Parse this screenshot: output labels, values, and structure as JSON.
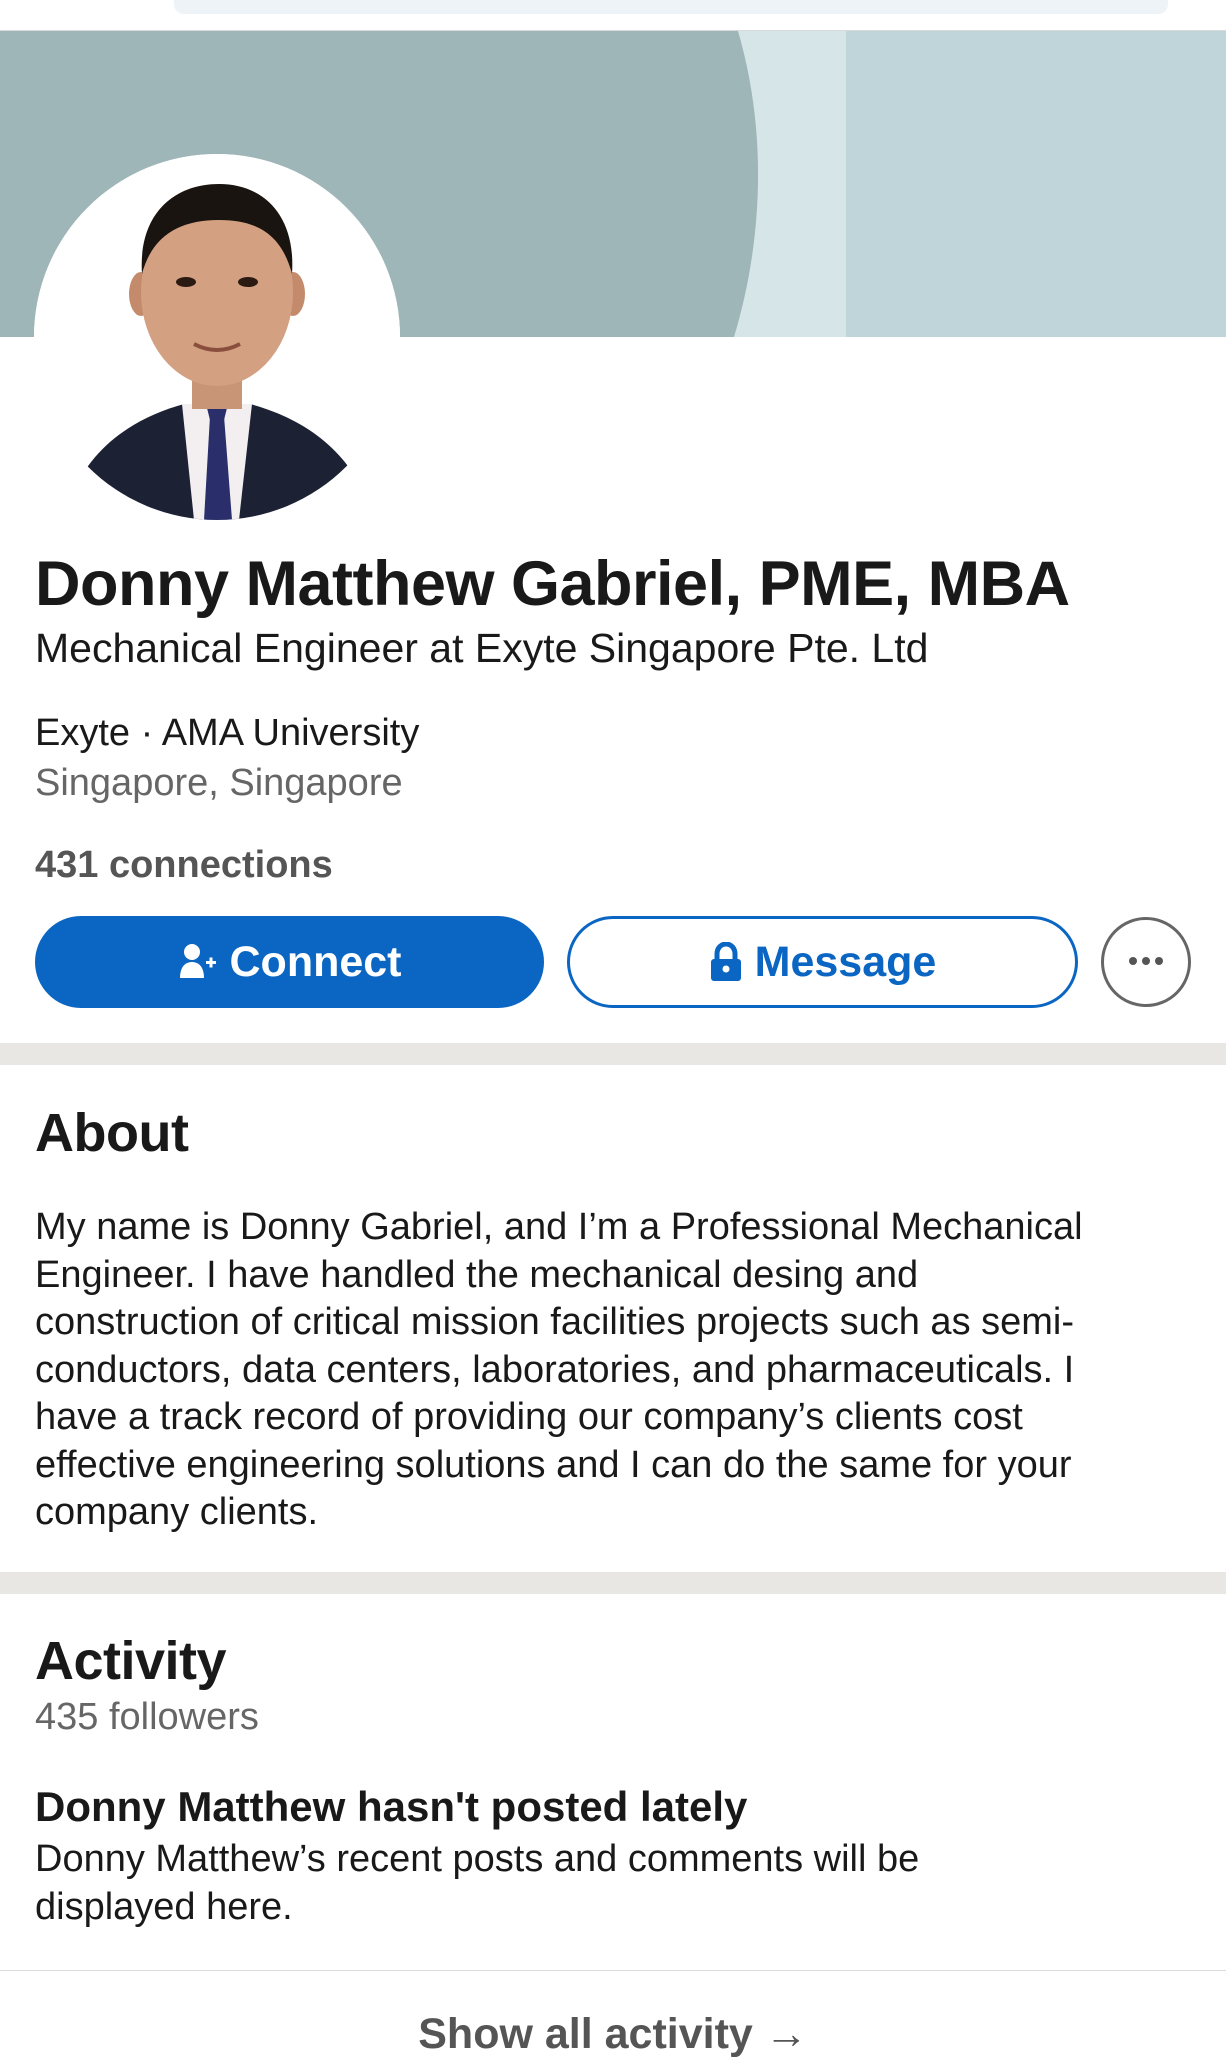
{
  "profile": {
    "name": "Donny Matthew Gabriel, PME, MBA",
    "headline": "Mechanical Engineer at Exyte Singapore Pte. Ltd",
    "org": "Exyte · AMA University",
    "location": "Singapore, Singapore",
    "connections": "431 connections"
  },
  "actions": {
    "connect_label": "Connect",
    "message_label": "Message"
  },
  "about": {
    "title": "About",
    "text": "My name is Donny Gabriel, and I’m a Professional Mechanical\nEngineer. I have handled the mechanical desing and\nconstruction of critical mission facilities projects such as semi-\nconductors, data centers, laboratories, and pharmaceuticals. I\nhave a track record of providing our company’s clients cost\neffective engineering solutions and I can do the same for your\ncompany clients."
  },
  "activity": {
    "title": "Activity",
    "followers": "435 followers",
    "empty_title": "Donny Matthew hasn't posted lately",
    "empty_desc": "Donny Matthew’s recent posts and comments will be\ndisplayed here.",
    "show_all": "Show all activity →"
  },
  "colors": {
    "primary": "#0a66c2",
    "banner_dark": "#9fb6b8",
    "banner_light": "#bfd5da",
    "divider": "#e8e7e3"
  },
  "icons": {
    "connect": "add-person-icon",
    "message": "lock-icon",
    "more": "more-options-icon"
  }
}
